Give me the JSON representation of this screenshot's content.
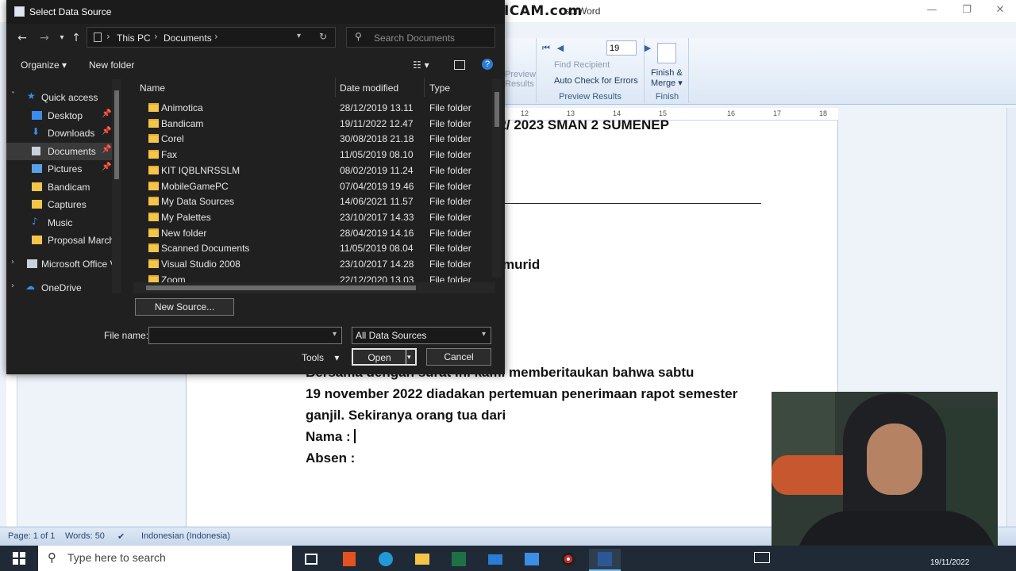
{
  "watermark": "www.BANDICAM.com",
  "word": {
    "title_partial": "sofWord",
    "ribbon": {
      "preview_results_partial": [
        "Preview",
        "Results"
      ],
      "record_number": "19",
      "find_recipient": "Find Recipient",
      "auto_check": "Auto Check for Errors",
      "group_preview": "Preview Results",
      "finish_merge": "Finish &",
      "finish_merge2": "Merge",
      "group_finish": "Finish"
    },
    "ruler_ticks": [
      "12",
      "13",
      "14",
      "15",
      "16",
      "17",
      "18"
    ],
    "document": {
      "line1_partial": "22/ 2023 SMAN 2 SUMENEP",
      "line2_partial": "murid",
      "line3_partial": "Bersama dengan surat ini kami memberitaukan bahwa sabtu",
      "line4": "19 november 2022 diadakan pertemuan penerimaan rapot semester",
      "line5": "ganjil. Sekiranya orang tua dari",
      "line6": "Nama  :",
      "line7": "Absen :"
    },
    "statusbar": {
      "page": "Page: 1 of 1",
      "words": "Words: 50",
      "language": "Indonesian (Indonesia)"
    }
  },
  "dialog": {
    "title": "Select Data Source",
    "breadcrumb": [
      "This PC",
      "Documents"
    ],
    "search_placeholder": "Search Documents",
    "toolbar": {
      "organize": "Organize",
      "new_folder": "New folder"
    },
    "nav": [
      {
        "label": "Quick access",
        "icon": "star-icon",
        "pinned": false
      },
      {
        "label": "Desktop",
        "icon": "desktop-icon",
        "pinned": true
      },
      {
        "label": "Downloads",
        "icon": "download-icon",
        "pinned": true
      },
      {
        "label": "Documents",
        "icon": "document-icon",
        "pinned": true
      },
      {
        "label": "Pictures",
        "icon": "picture-icon",
        "pinned": true
      },
      {
        "label": "Bandicam",
        "icon": "folder-icon",
        "pinned": false
      },
      {
        "label": "Captures",
        "icon": "folder-icon",
        "pinned": false
      },
      {
        "label": "Music",
        "icon": "music-icon",
        "pinned": false
      },
      {
        "label": "Proposal Marchi",
        "icon": "folder-icon",
        "pinned": false
      },
      {
        "label": "Microsoft Office V",
        "icon": "office-icon",
        "pinned": false
      },
      {
        "label": "OneDrive",
        "icon": "cloud-icon",
        "pinned": false
      }
    ],
    "columns": {
      "name": "Name",
      "date": "Date modified",
      "type": "Type"
    },
    "files": [
      {
        "name": "Animotica",
        "date": "28/12/2019 13.11",
        "type": "File folder"
      },
      {
        "name": "Bandicam",
        "date": "19/11/2022 12.47",
        "type": "File folder"
      },
      {
        "name": "Corel",
        "date": "30/08/2018 21.18",
        "type": "File folder"
      },
      {
        "name": "Fax",
        "date": "11/05/2019 08.10",
        "type": "File folder"
      },
      {
        "name": "KIT IQBLNRSSLM",
        "date": "08/02/2019 11.24",
        "type": "File folder"
      },
      {
        "name": "MobileGamePC",
        "date": "07/04/2019 19.46",
        "type": "File folder"
      },
      {
        "name": "My Data Sources",
        "date": "14/06/2021 11.57",
        "type": "File folder"
      },
      {
        "name": "My Palettes",
        "date": "23/10/2017 14.33",
        "type": "File folder"
      },
      {
        "name": "New folder",
        "date": "28/04/2019 14.16",
        "type": "File folder"
      },
      {
        "name": "Scanned Documents",
        "date": "11/05/2019 08.04",
        "type": "File folder"
      },
      {
        "name": "Visual Studio 2008",
        "date": "23/10/2017 14.28",
        "type": "File folder"
      },
      {
        "name": "Zoom",
        "date": "22/12/2020 13.03",
        "type": "File folder"
      }
    ],
    "new_source": "New Source...",
    "file_name_label": "File name:",
    "file_name_value": "",
    "filter": "All Data Sources",
    "tools": "Tools",
    "open": "Open",
    "cancel": "Cancel"
  },
  "taskbar": {
    "search_placeholder": "Type here to search",
    "clock_partial": "19/11/2022"
  }
}
